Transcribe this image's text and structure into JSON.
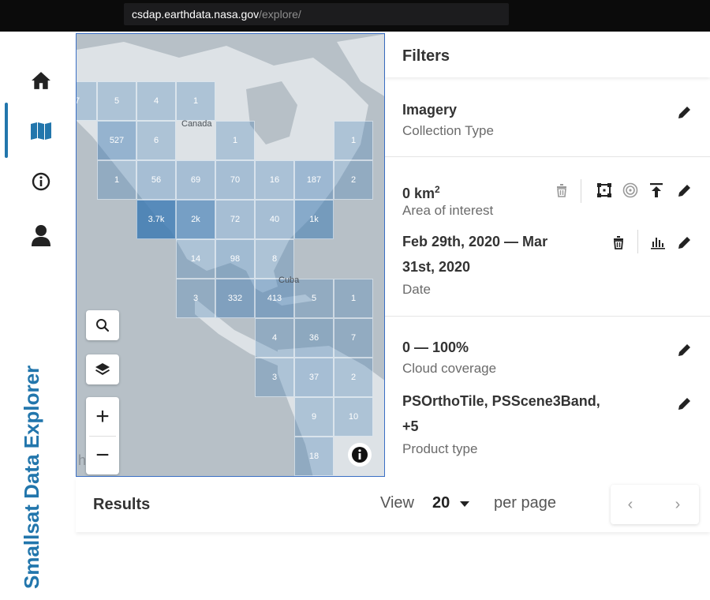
{
  "browser": {
    "url_host": "csdap.earthdata.nasa.gov",
    "url_path": "/explore/"
  },
  "app": {
    "brand": "Smallsat Data Explorer"
  },
  "nav": [
    "home-icon",
    "map-icon",
    "info-icon",
    "user-icon"
  ],
  "map": {
    "labels": {
      "canada": "Canada",
      "cuba": "Cuba",
      "partial_left": "h"
    },
    "tiles": [
      {
        "label": "7",
        "shade": 0.3
      },
      {
        "label": "5",
        "shade": 0.3
      },
      {
        "label": "4",
        "shade": 0.3
      },
      {
        "label": "1",
        "shade": 0.3
      },
      {
        "label": "527",
        "shade": 0.45
      },
      {
        "label": "6",
        "shade": 0.3
      },
      {
        "label": "1",
        "shade": 0.3
      },
      {
        "label": "1",
        "shade": 0.3
      },
      {
        "label": "1",
        "shade": 0.3
      },
      {
        "label": "56",
        "shade": 0.35
      },
      {
        "label": "69",
        "shade": 0.35
      },
      {
        "label": "70",
        "shade": 0.35
      },
      {
        "label": "16",
        "shade": 0.32
      },
      {
        "label": "187",
        "shade": 0.4
      },
      {
        "label": "2",
        "shade": 0.3
      },
      {
        "label": "3.7k",
        "shade": 0.85
      },
      {
        "label": "2k",
        "shade": 0.65
      },
      {
        "label": "72",
        "shade": 0.35
      },
      {
        "label": "40",
        "shade": 0.35
      },
      {
        "label": "1k",
        "shade": 0.55
      },
      {
        "label": "14",
        "shade": 0.3
      },
      {
        "label": "98",
        "shade": 0.38
      },
      {
        "label": "8",
        "shade": 0.3
      },
      {
        "label": "3",
        "shade": 0.3
      },
      {
        "label": "332",
        "shade": 0.45
      },
      {
        "label": "413",
        "shade": 0.45
      },
      {
        "label": "5",
        "shade": 0.3
      },
      {
        "label": "1",
        "shade": 0.3
      },
      {
        "label": "4",
        "shade": 0.3
      },
      {
        "label": "36",
        "shade": 0.35
      },
      {
        "label": "7",
        "shade": 0.3
      },
      {
        "label": "3",
        "shade": 0.3
      },
      {
        "label": "37",
        "shade": 0.35
      },
      {
        "label": "2",
        "shade": 0.3
      },
      {
        "label": "9",
        "shade": 0.3
      },
      {
        "label": "10",
        "shade": 0.3
      },
      {
        "label": "18",
        "shade": 0.32
      }
    ],
    "controls": [
      "search-icon",
      "layers-icon",
      "zoom-in-icon",
      "zoom-out-icon",
      "info-icon"
    ],
    "zoom_in": "+",
    "zoom_out": "−"
  },
  "filters": {
    "title": "Filters",
    "imagery": {
      "value": "Imagery",
      "caption": "Collection Type"
    },
    "aoi": {
      "value": "0 km",
      "sup": "2",
      "caption": "Area of interest"
    },
    "date": {
      "value_line1": "Feb 29th, 2020 — Mar",
      "value_line2": "31st, 2020",
      "caption": "Date"
    },
    "cloud": {
      "value": "0 — 100%",
      "caption": "Cloud coverage"
    },
    "product": {
      "value_line1": "PSOrthoTile, PSScene3Band,",
      "value_line2": "+5",
      "caption": "Product type"
    }
  },
  "results": {
    "title": "Results",
    "view_label": "View",
    "per_page_value": "20",
    "per_page_label": "per page",
    "prev": "‹",
    "next": "›"
  },
  "colors": {
    "brand": "#2276ac",
    "tile": "#3f7bb3",
    "map_bg": "#b9c2c8"
  }
}
